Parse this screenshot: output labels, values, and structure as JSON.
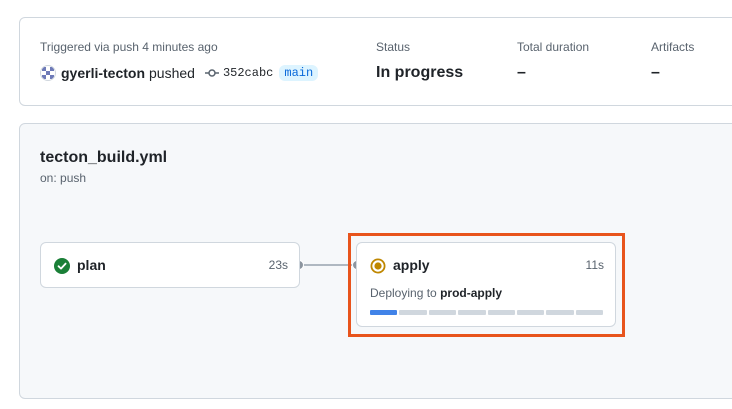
{
  "summary": {
    "trigger_label": "Triggered via push 4 minutes ago",
    "username": "gyerli-tecton",
    "action": "pushed",
    "commit_sha": "352cabc",
    "branch": "main",
    "status_label": "Status",
    "status_value": "In progress",
    "duration_label": "Total duration",
    "duration_value": "–",
    "artifacts_label": "Artifacts",
    "artifacts_value": "–"
  },
  "workflow": {
    "title": "tecton_build.yml",
    "subtitle": "on: push",
    "jobs": [
      {
        "name": "plan",
        "duration": "23s",
        "status": "success",
        "icon": "check-circle-icon",
        "color": "#1a7f37"
      },
      {
        "name": "apply",
        "duration": "11s",
        "status": "in_progress",
        "icon": "in-progress-icon",
        "color": "#bf8700",
        "description_prefix": "Deploying to",
        "environment": "prod-apply",
        "progress_segments": 8,
        "progress_filled": 1
      }
    ]
  },
  "colors": {
    "highlight": "#e8541c",
    "progress": "#4183e8",
    "link": "#0969da"
  }
}
